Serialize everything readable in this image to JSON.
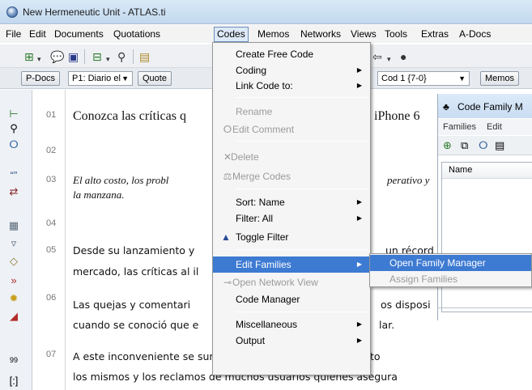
{
  "window": {
    "title": "New Hermeneutic Unit - ATLAS.ti"
  },
  "menubar": {
    "items": [
      "File",
      "Edit",
      "Documents",
      "Quotations",
      "Codes",
      "Memos",
      "Networks",
      "Views",
      "Tools",
      "Extras",
      "A-Docs"
    ],
    "active": "Codes"
  },
  "toolbar": {
    "icons": [
      "new-code-icon",
      "comment-icon",
      "save-icon",
      "code-tool-icon",
      "find-icon",
      "open-icon",
      "back-icon",
      "bomb-icon"
    ]
  },
  "selectorbar": {
    "pdocs_label": "P-Docs",
    "pdoc_value": "P1: Diario el",
    "quotes_label": "Quote",
    "code_value": "Cod 1 {7-0}",
    "memos_label": "Memos"
  },
  "document": {
    "paragraph_numbers": [
      "01",
      "02",
      "03",
      "04",
      "05",
      "06",
      "07"
    ],
    "lines": {
      "p01": "Conozca las críticas q",
      "p01_tail": "iPhone 6",
      "p03a_head": "El alto costo, los probl",
      "p03a_tail": "perativo y",
      "p03b": "la manzana.",
      "p05a_head": "Desde su lanzamiento y",
      "p05a_tail": "un récord",
      "p05b_head": "mercado, las críticas al il",
      "p06a_head": "Las quejas y comentari",
      "p06a_tail": "os disposi",
      "p06b_head": "cuando se conoció que e",
      "p06b_tail": "lar.",
      "p07a": "A este inconveniente se sumaron el revuelo por el alto costo",
      "p07b": "los mismos y los reclamos de muchos usuarios quienes asegura"
    }
  },
  "code_family_manager": {
    "title": "Code Family M",
    "menu": [
      "Families",
      "Edit"
    ],
    "column_name": "Name"
  },
  "codes_menu": {
    "items": [
      {
        "label": "Create Free Code",
        "icon": "",
        "submenu": false,
        "disabled": false
      },
      {
        "label": "Coding",
        "icon": "",
        "submenu": true,
        "disabled": false
      },
      {
        "label": "Link Code to:",
        "icon": "",
        "submenu": true,
        "disabled": false
      },
      {
        "label": "Rename",
        "icon": "",
        "submenu": false,
        "disabled": true
      },
      {
        "label": "Edit Comment",
        "icon": "comment-icon",
        "submenu": false,
        "disabled": true
      },
      {
        "label": "Delete",
        "icon": "delete-icon",
        "submenu": false,
        "disabled": true
      },
      {
        "label": "Merge Codes",
        "icon": "merge-icon",
        "submenu": false,
        "disabled": true
      },
      {
        "label": "Sort: Name",
        "icon": "",
        "submenu": true,
        "disabled": false
      },
      {
        "label": "Filter: All",
        "icon": "",
        "submenu": true,
        "disabled": false
      },
      {
        "label": "Toggle Filter",
        "icon": "filter-icon",
        "submenu": false,
        "disabled": false
      },
      {
        "label": "Edit Families",
        "icon": "",
        "submenu": true,
        "disabled": false,
        "highlighted": true
      },
      {
        "label": "Open Network View",
        "icon": "network-icon",
        "submenu": false,
        "disabled": true
      },
      {
        "label": "Code Manager",
        "icon": "",
        "submenu": false,
        "disabled": false
      },
      {
        "label": "Miscellaneous",
        "icon": "",
        "submenu": true,
        "disabled": false
      },
      {
        "label": "Output",
        "icon": "",
        "submenu": true,
        "disabled": false
      }
    ]
  },
  "families_submenu": {
    "items": [
      {
        "label": "Open Family Manager",
        "disabled": false,
        "highlighted": true
      },
      {
        "label": "Assign Families",
        "disabled": true
      }
    ]
  },
  "colors": {
    "highlight": "#3d7ad2",
    "menu_bg": "#f5f5f5",
    "titlebar": "#c2d8ee"
  }
}
